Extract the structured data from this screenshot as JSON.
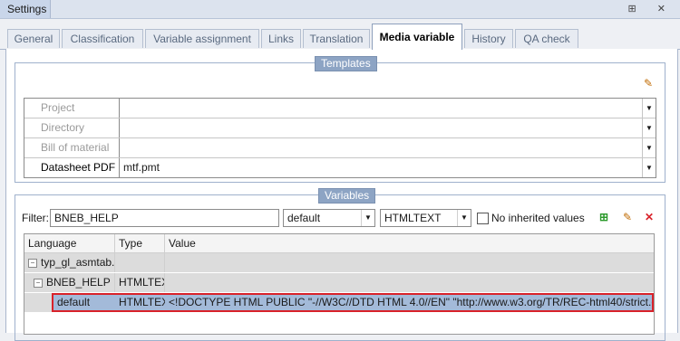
{
  "window": {
    "title": "Settings",
    "icons": "⊞ ✕"
  },
  "tabs": [
    "General",
    "Classification",
    "Variable assignment",
    "Links",
    "Translation",
    "Media variable",
    "History",
    "QA check"
  ],
  "templates": {
    "group_label": "Templates",
    "rows": [
      {
        "label": "Project",
        "value": ""
      },
      {
        "label": "Directory",
        "value": ""
      },
      {
        "label": "Bill of material",
        "value": ""
      },
      {
        "label": "Datasheet PDF",
        "value": "mtf.pmt"
      }
    ]
  },
  "variables": {
    "group_label": "Variables",
    "filter_label": "Filter:",
    "filter_value": "BNEB_HELP",
    "language_select": "default",
    "type_select": "HTMLTEXT",
    "no_inherited_label": "No inherited values",
    "grid": {
      "columns": [
        "Language",
        "Type",
        "Value"
      ],
      "rows": [
        {
          "language": "typ_gl_asmtab.pmf",
          "type": "",
          "value": ""
        },
        {
          "language": "BNEB_HELP",
          "type": "HTMLTEXT",
          "value": ""
        },
        {
          "language": "default",
          "type": "HTMLTEXT",
          "value": "<!DOCTYPE HTML PUBLIC \"-//W3C//DTD HTML 4.0//EN\" \"http://www.w3.org/TR/REC-html40/strict.dtd\"><html><h"
        }
      ]
    }
  },
  "colors": {
    "selection": "#a3bad9",
    "highlight_border": "#d9222a"
  }
}
